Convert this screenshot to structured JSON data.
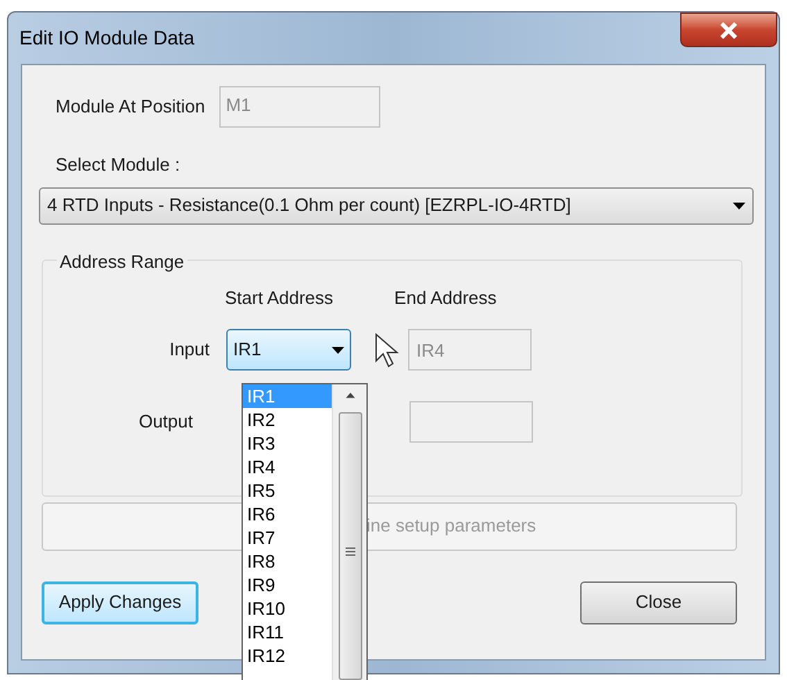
{
  "window": {
    "title": "Edit IO Module Data"
  },
  "module_at_position": {
    "label": "Module At Position",
    "value": "M1",
    "disabled": true
  },
  "select_module": {
    "label": "Select Module :",
    "value": "4 RTD Inputs - Resistance(0.1 Ohm per count) [EZRPL-IO-4RTD]"
  },
  "address_range": {
    "title": "Address Range",
    "columns": [
      "Start Address",
      "End Address"
    ],
    "rows": [
      {
        "label": "Input",
        "start": "IR1",
        "end": "IR4"
      },
      {
        "label": "Output"
      }
    ]
  },
  "dropdown": {
    "items": [
      {
        "label": "IR1",
        "selected": true
      },
      {
        "label": "IR2",
        "selected": false
      },
      {
        "label": "IR3",
        "selected": false
      },
      {
        "label": "IR4",
        "selected": false
      },
      {
        "label": "IR5",
        "selected": false
      },
      {
        "label": "IR6",
        "selected": false
      },
      {
        "label": "IR7",
        "selected": false
      },
      {
        "label": "IR8",
        "selected": false
      },
      {
        "label": "IR9",
        "selected": false
      },
      {
        "label": "IR10",
        "selected": false
      },
      {
        "label": "IR11",
        "selected": false
      },
      {
        "label": "IR12",
        "selected": false
      }
    ]
  },
  "setup_button": {
    "label": "ine setup parameters",
    "disabled": true
  },
  "buttons": [
    {
      "label": "Apply Changes",
      "focused": true
    },
    {
      "label": "Close",
      "focused": false
    }
  ]
}
